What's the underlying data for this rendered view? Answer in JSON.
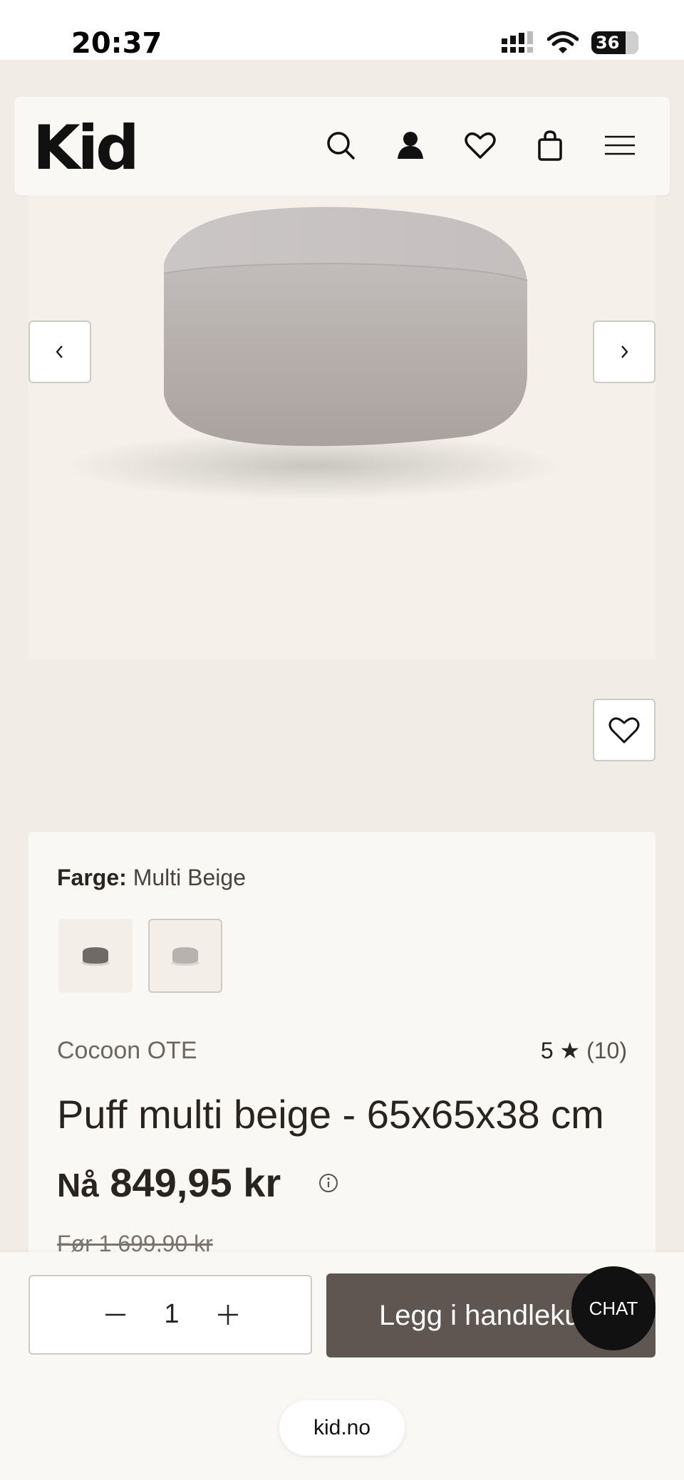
{
  "status_bar": {
    "time": "20:37",
    "battery": "36",
    "icons": [
      "cellular-signal-icon",
      "wifi-icon",
      "battery-icon"
    ]
  },
  "header": {
    "logo": "Kid",
    "icons": [
      "search-icon",
      "user-icon",
      "heart-icon",
      "shopping-bag-icon",
      "menu-icon"
    ]
  },
  "gallery": {
    "prev_icon": "chevron-left-icon",
    "next_icon": "chevron-right-icon",
    "wishlist_icon": "heart-icon"
  },
  "product": {
    "color_label": "Farge:",
    "color_value": "Multi Beige",
    "swatches": [
      "dark-grey",
      "multi-beige"
    ],
    "brand": "Cocoon OTE",
    "rating_value": "5 ★",
    "rating_count": "(10)",
    "title": "Puff multi beige - 65x65x38 cm",
    "price_prefix": "Nå",
    "price": "849,95 kr",
    "old_price": "Før 1 699,90 kr"
  },
  "purchase": {
    "quantity": "1",
    "add_to_cart": "Legg i handlekurv",
    "chat": "CHAT"
  },
  "browser": {
    "url": "kid.no"
  },
  "colors": {
    "background": "#f1ede6",
    "card": "#faf8f4",
    "primary_button": "#5f5651",
    "text": "#2a2421"
  }
}
